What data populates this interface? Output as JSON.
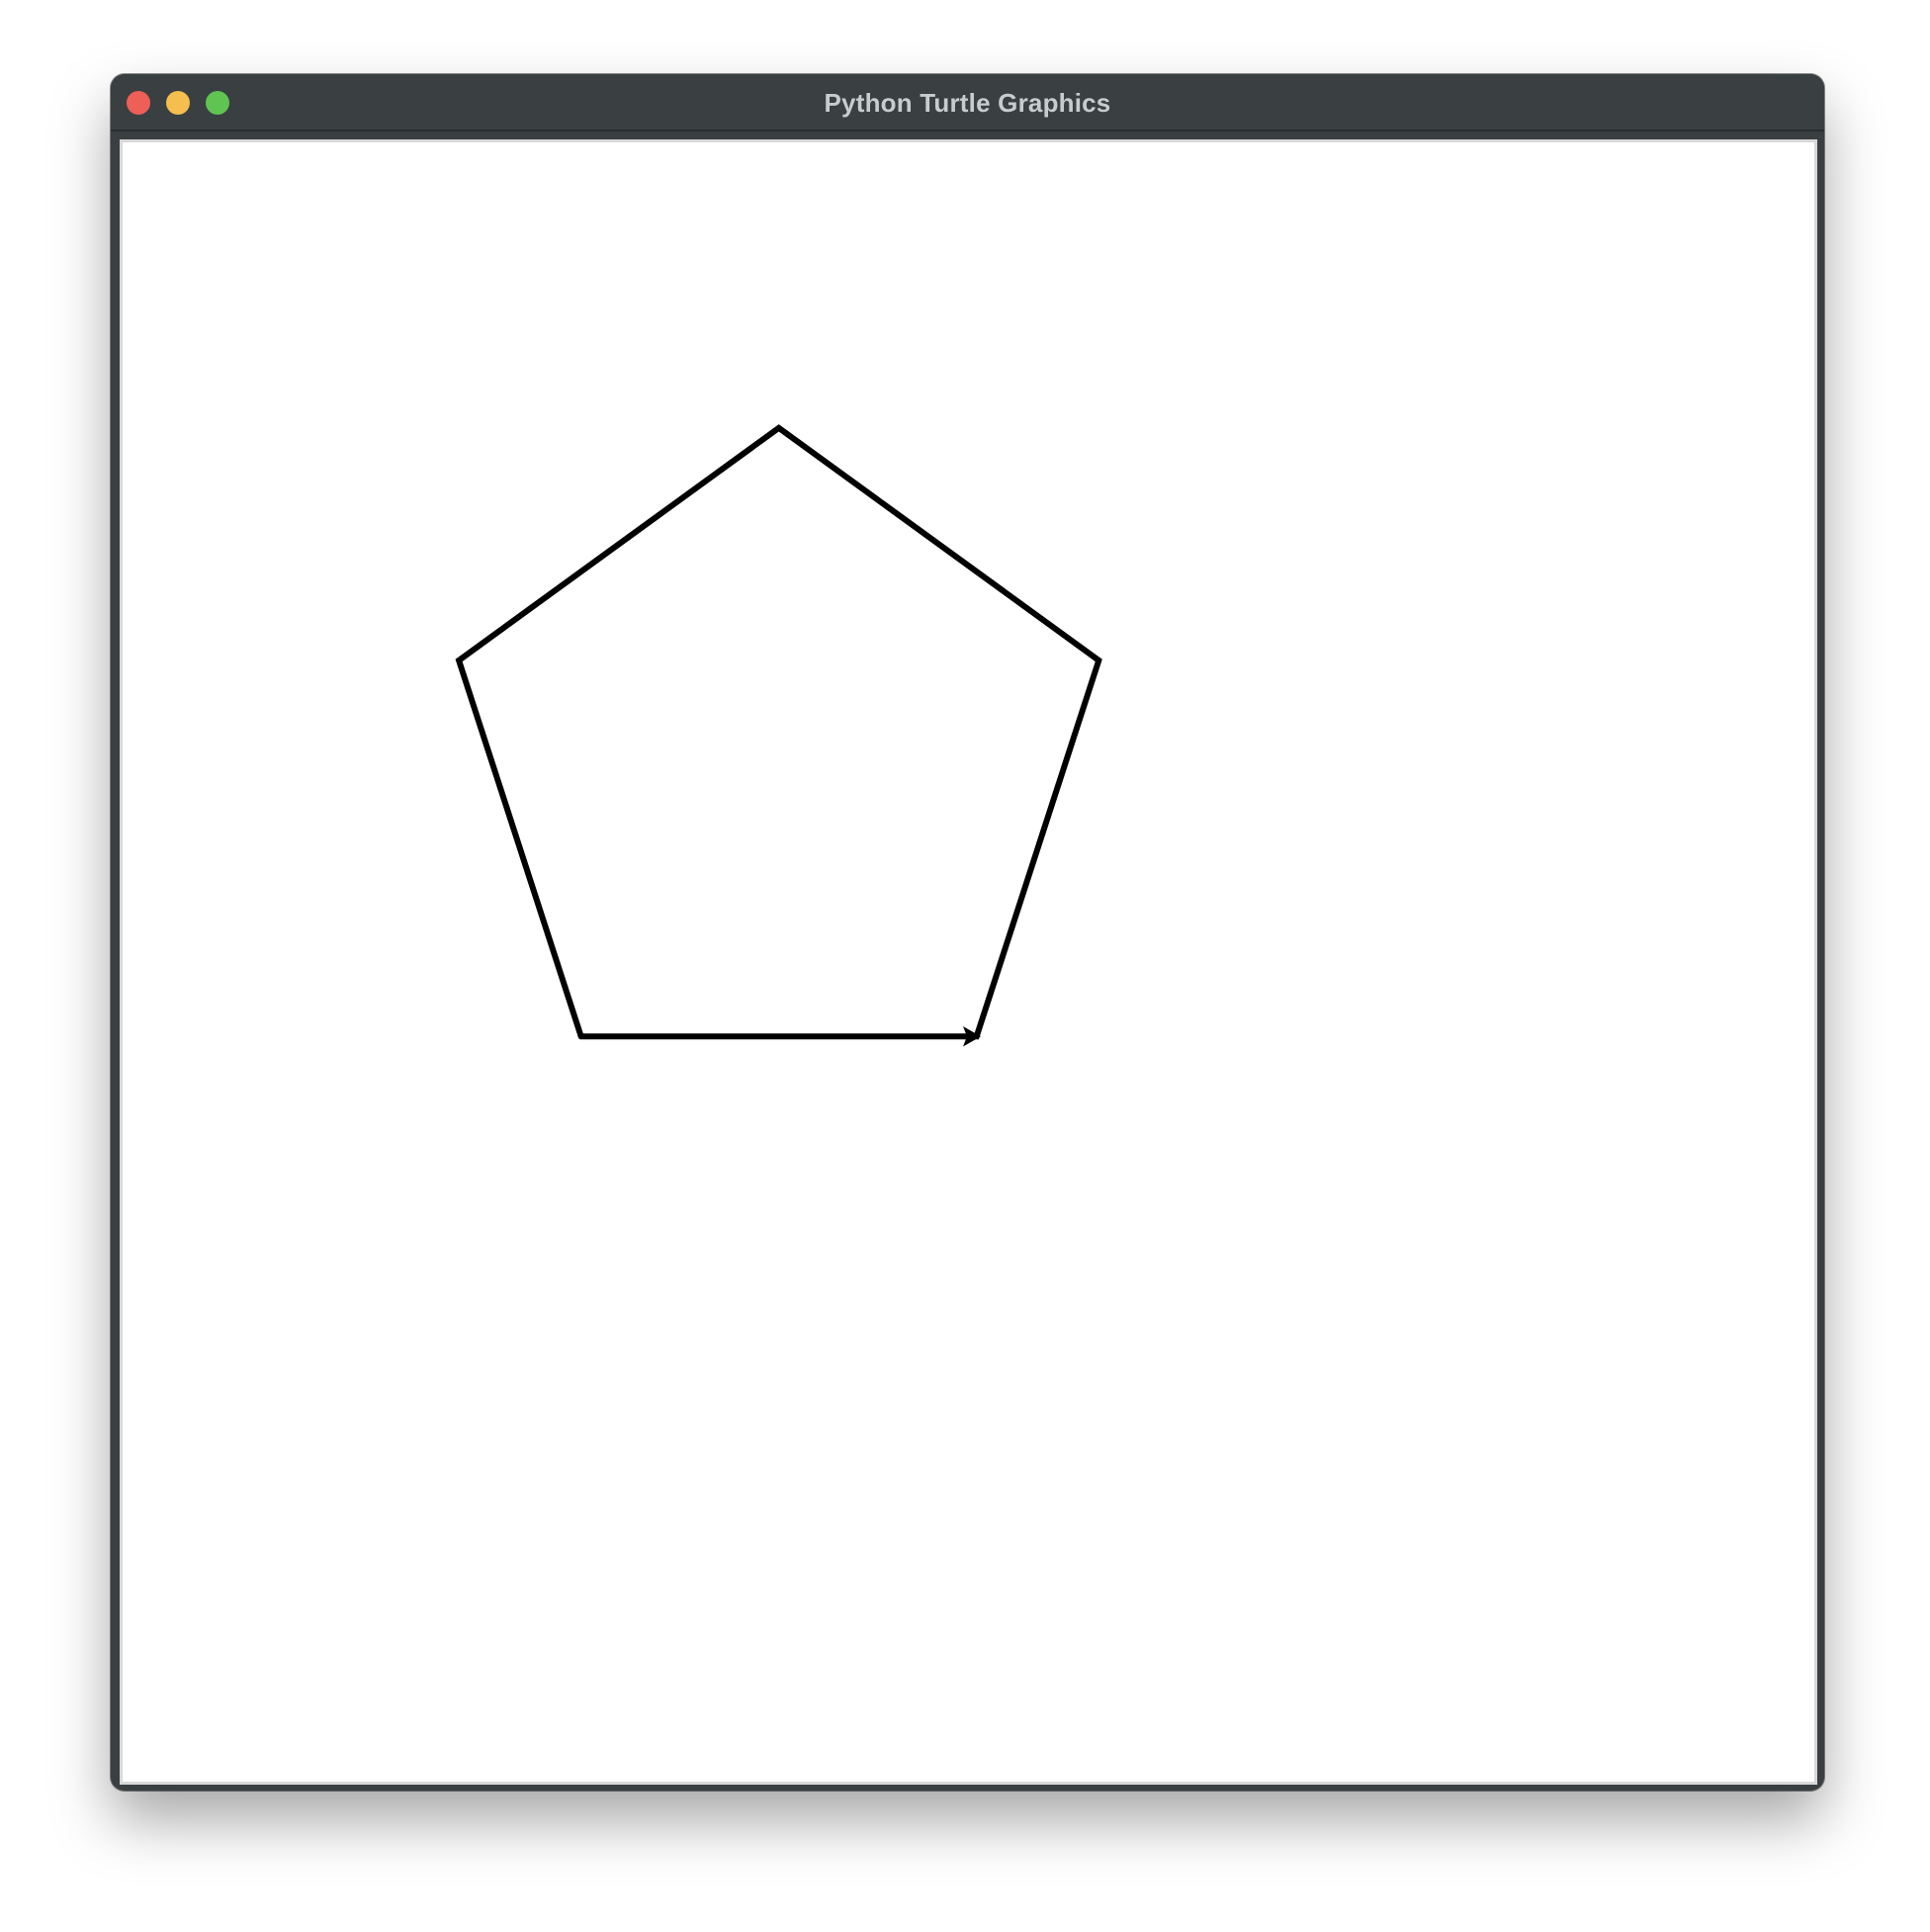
{
  "window": {
    "title": "Python Turtle Graphics",
    "controls": {
      "close": {
        "color": "#ee5f57"
      },
      "minimize": {
        "color": "#f5be4f"
      },
      "zoom": {
        "color": "#5fc451"
      }
    }
  },
  "canvas": {
    "background": "#ffffff",
    "drawing": {
      "shape": "pentagon",
      "stroke_color": "#000000",
      "turtle_cursor": "arrow-icon",
      "turtle_heading": "right"
    }
  }
}
